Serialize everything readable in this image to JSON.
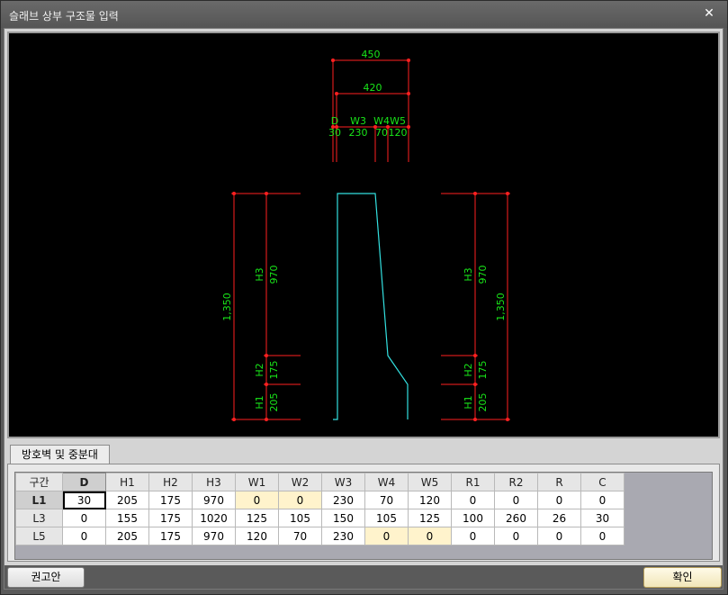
{
  "window": {
    "title": "슬래브 상부 구조물 입력",
    "close_glyph": "✕"
  },
  "drawing": {
    "colors": {
      "dimension": "#ff2020",
      "text": "#19e619",
      "profile": "#33e0e0",
      "background": "#000000"
    },
    "top_dims": {
      "total": "450",
      "inner": "420"
    },
    "width_labels": [
      "D",
      "W3",
      "W4",
      "W5"
    ],
    "width_values": [
      "30",
      "230",
      "70",
      "120"
    ],
    "left_dims": {
      "total": "1,350",
      "h3": "H3",
      "h3_val": "970",
      "h2": "H2",
      "h2_val": "175",
      "h1": "H1",
      "h1_val": "205"
    },
    "right_dims": {
      "total": "1,350",
      "h3": "H3",
      "h3_val": "970",
      "h2": "H2",
      "h2_val": "175",
      "h1": "H1",
      "h1_val": "205"
    }
  },
  "tab": {
    "label": "방호벽 및 중분대"
  },
  "table": {
    "corner": "구간",
    "columns": [
      "D",
      "H1",
      "H2",
      "H3",
      "W1",
      "W2",
      "W3",
      "W4",
      "W5",
      "R1",
      "R2",
      "R",
      "C"
    ],
    "rows": [
      {
        "label": "L1",
        "values": [
          "30",
          "205",
          "175",
          "970",
          "0",
          "0",
          "230",
          "70",
          "120",
          "0",
          "0",
          "0",
          "0"
        ]
      },
      {
        "label": "L3",
        "values": [
          "0",
          "155",
          "175",
          "1020",
          "125",
          "105",
          "150",
          "105",
          "125",
          "100",
          "260",
          "26",
          "30"
        ]
      },
      {
        "label": "L5",
        "values": [
          "0",
          "205",
          "175",
          "970",
          "120",
          "70",
          "230",
          "0",
          "0",
          "0",
          "0",
          "0",
          "0"
        ]
      }
    ],
    "highlight_color": "#fff3cc"
  },
  "buttons": {
    "recommend": "권고안",
    "confirm": "확인"
  }
}
